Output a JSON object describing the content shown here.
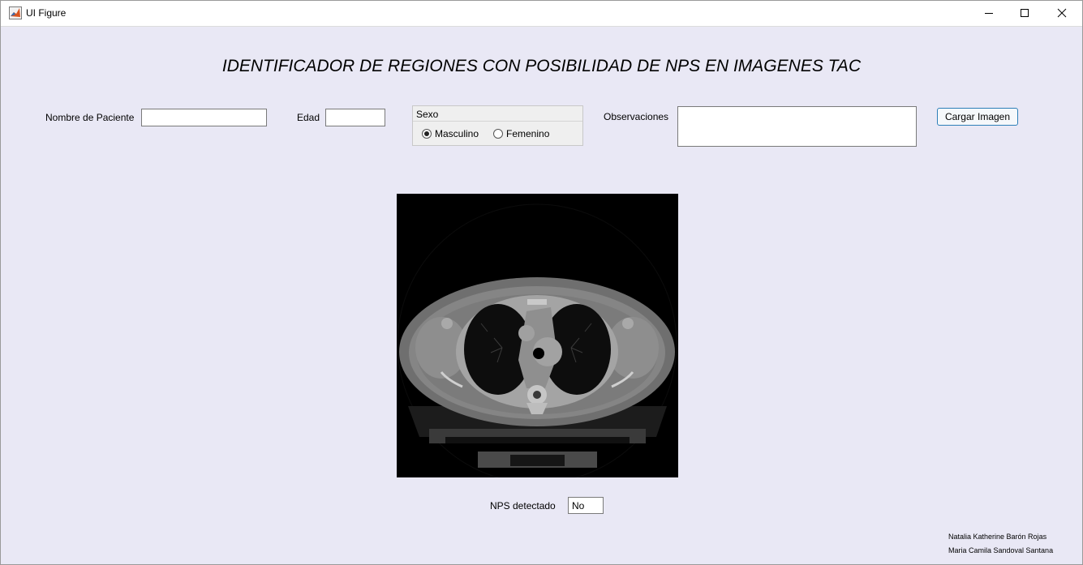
{
  "window": {
    "title": "UI Figure",
    "controls": {
      "minimize": "minimize-icon",
      "maximize": "maximize-icon",
      "close": "close-icon"
    }
  },
  "header": {
    "title": "IDENTIFICADOR DE REGIONES CON POSIBILIDAD DE NPS EN IMAGENES TAC"
  },
  "form": {
    "patient_name_label": "Nombre de Paciente",
    "patient_name_value": "",
    "age_label": "Edad",
    "age_value": "",
    "sex_group": {
      "title": "Sexo",
      "options": [
        {
          "label": "Masculino",
          "selected": true
        },
        {
          "label": "Femenino",
          "selected": false
        }
      ]
    },
    "observations_label": "Observaciones",
    "observations_value": "",
    "load_button_label": "Cargar Imagen"
  },
  "image": {
    "description_icon": "ct-scan-image"
  },
  "result": {
    "nps_label": "NPS detectado",
    "nps_value": "No"
  },
  "credits": [
    "Natalia Katherine Barón Rojas",
    "Maria Camila Sandoval Santana"
  ]
}
